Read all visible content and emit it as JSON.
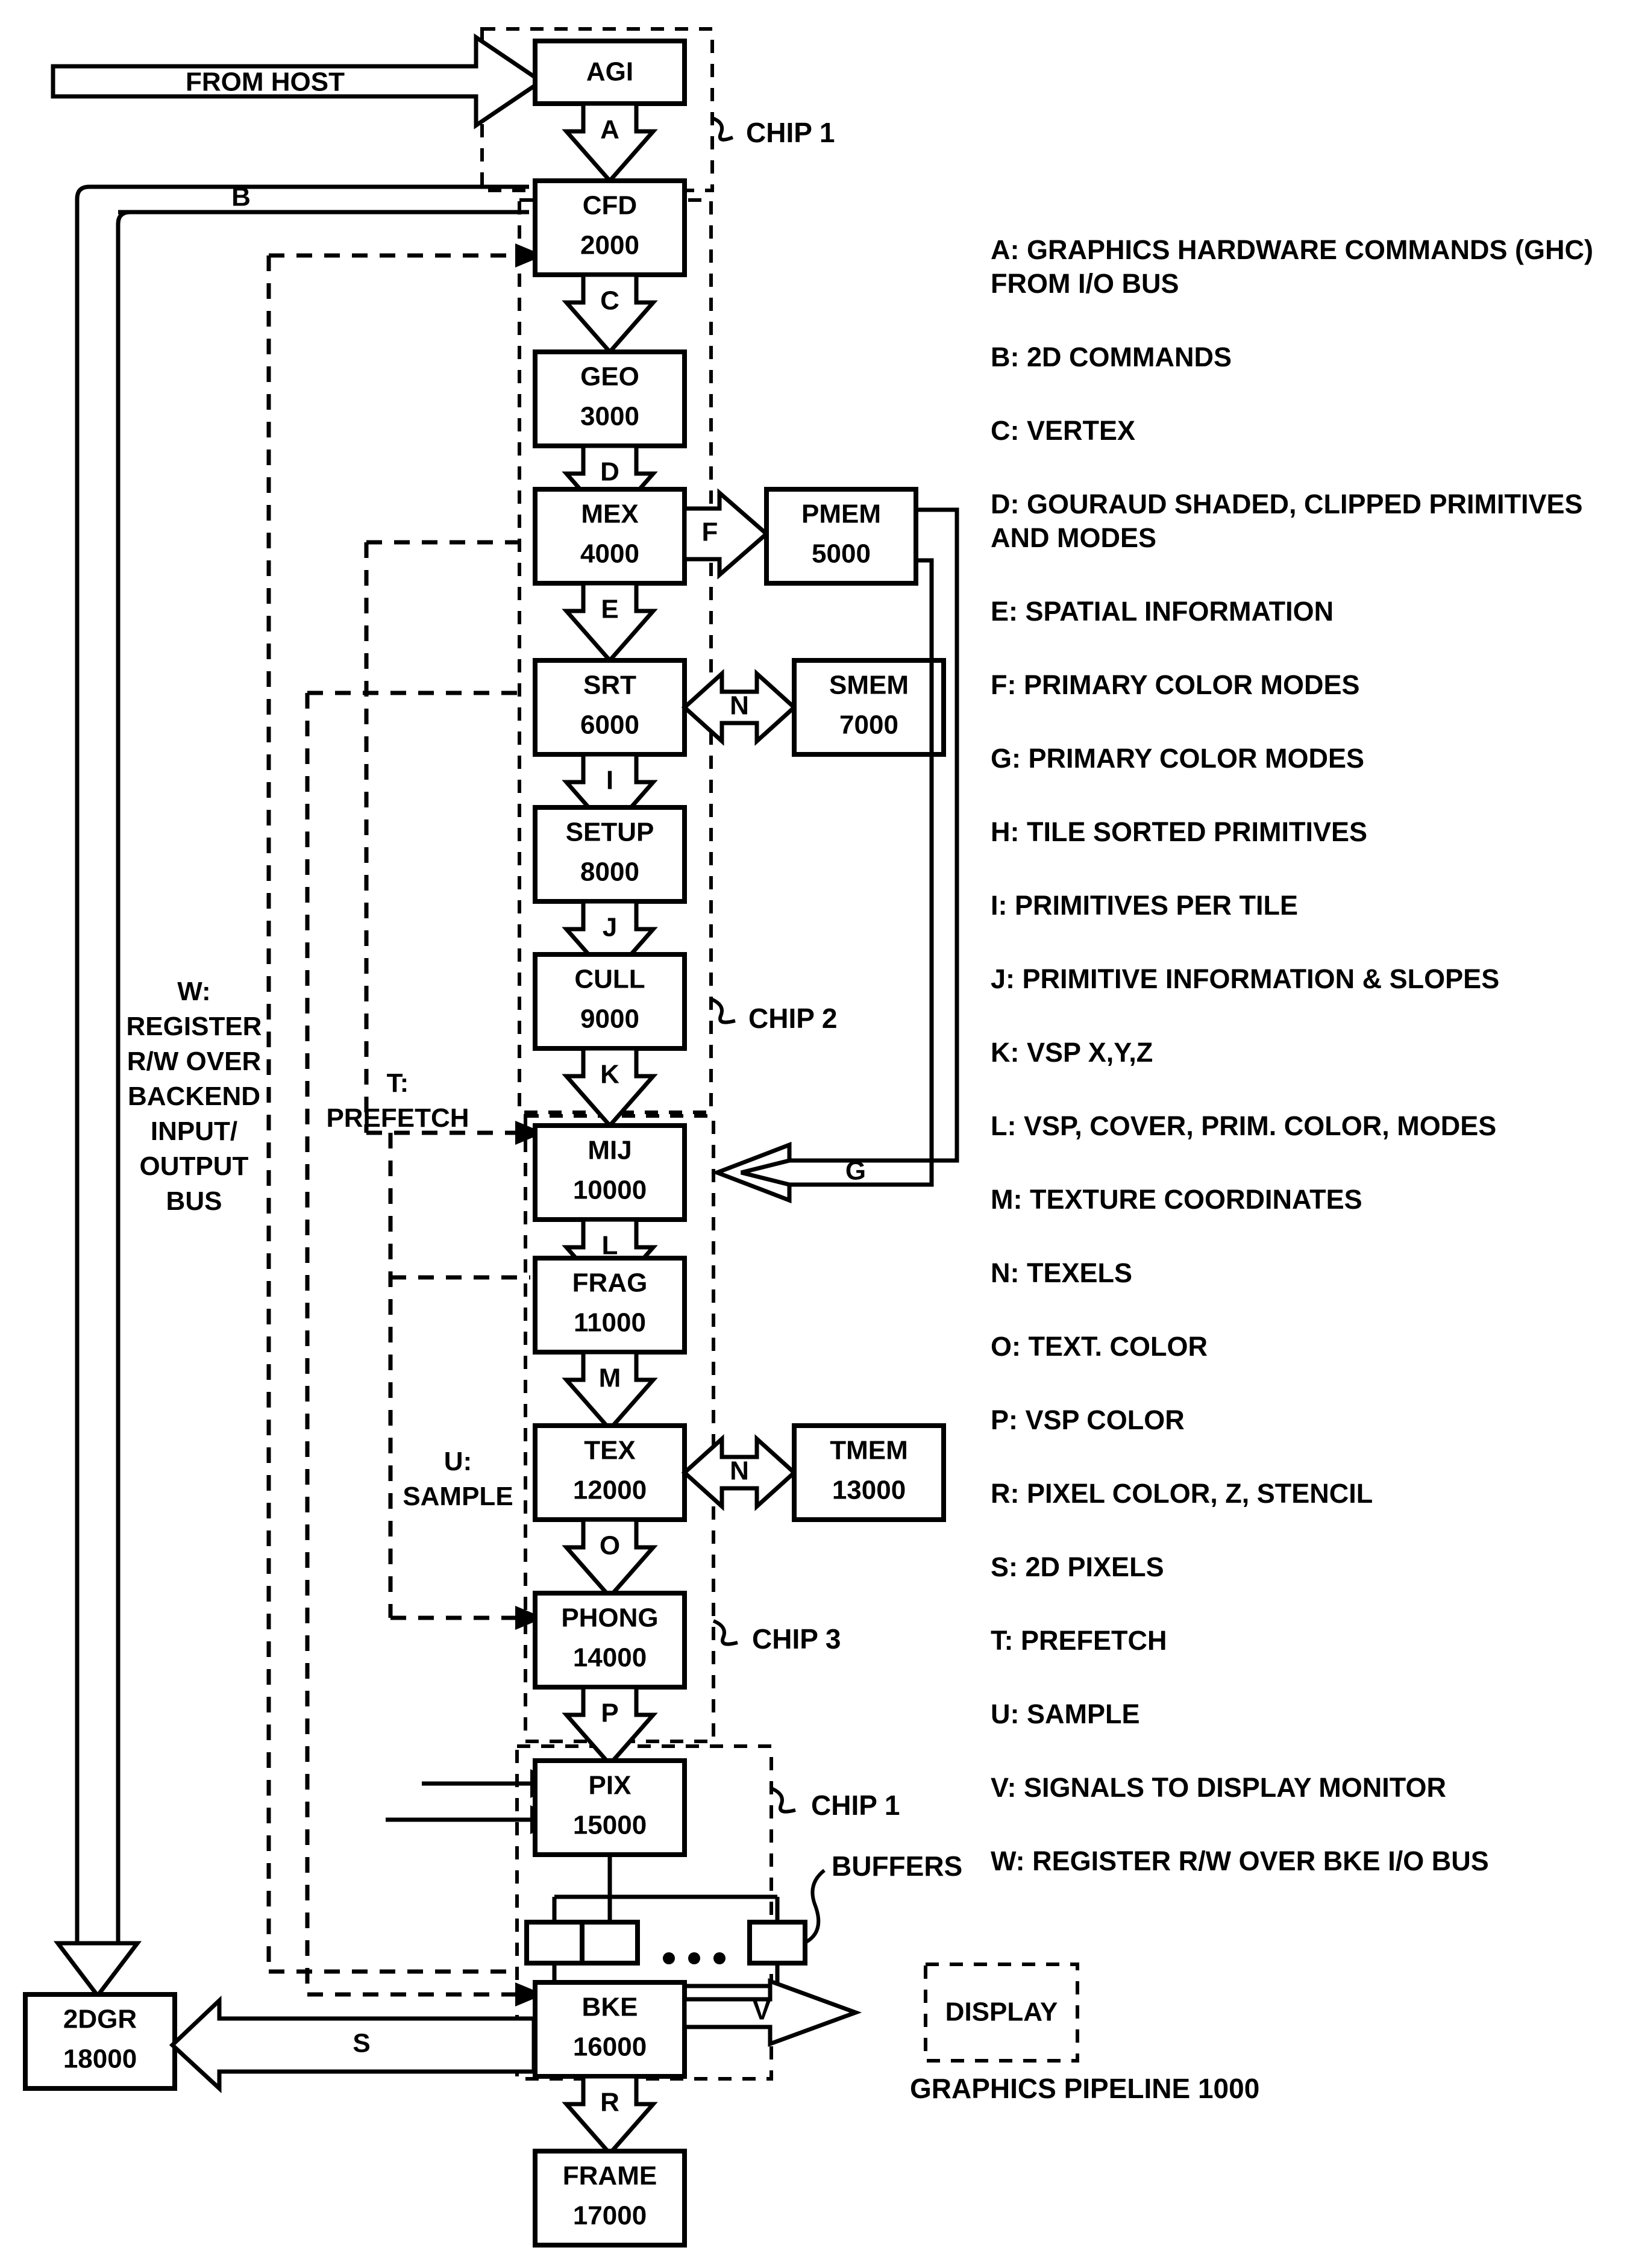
{
  "title": "GRAPHICS PIPELINE 1000",
  "blocks": [
    {
      "id": "agi",
      "name": "AGI",
      "num": ""
    },
    {
      "id": "cfd",
      "name": "CFD",
      "num": "2000"
    },
    {
      "id": "geo",
      "name": "GEO",
      "num": "3000"
    },
    {
      "id": "mex",
      "name": "MEX",
      "num": "4000"
    },
    {
      "id": "pmem",
      "name": "PMEM",
      "num": "5000"
    },
    {
      "id": "srt",
      "name": "SRT",
      "num": "6000"
    },
    {
      "id": "smem",
      "name": "SMEM",
      "num": "7000"
    },
    {
      "id": "setup",
      "name": "SETUP",
      "num": "8000"
    },
    {
      "id": "cull",
      "name": "CULL",
      "num": "9000"
    },
    {
      "id": "mij",
      "name": "MIJ",
      "num": "10000"
    },
    {
      "id": "frag",
      "name": "FRAG",
      "num": "11000"
    },
    {
      "id": "tex",
      "name": "TEX",
      "num": "12000"
    },
    {
      "id": "tmem",
      "name": "TMEM",
      "num": "13000"
    },
    {
      "id": "phong",
      "name": "PHONG",
      "num": "14000"
    },
    {
      "id": "pix",
      "name": "PIX",
      "num": "15000"
    },
    {
      "id": "bke",
      "name": "BKE",
      "num": "16000"
    },
    {
      "id": "frame",
      "name": "FRAME",
      "num": "17000"
    },
    {
      "id": "twodgr",
      "name": "2DGR",
      "num": "18000"
    },
    {
      "id": "display",
      "name": "DISPLAY",
      "num": ""
    }
  ],
  "flow_labels": {
    "a": "A",
    "b": "B",
    "c": "C",
    "d": "D",
    "e": "E",
    "f": "F",
    "g": "G",
    "i": "I",
    "j": "J",
    "k": "K",
    "l": "L",
    "m": "M",
    "n1": "N",
    "n2": "N",
    "o": "O",
    "p": "P",
    "r": "R",
    "s": "S",
    "v": "V"
  },
  "annotations": {
    "from_host": "FROM HOST",
    "chip1_top": "CHIP 1",
    "chip2": "CHIP 2",
    "chip3": "CHIP 3",
    "chip1_bottom": "CHIP 1",
    "buffers": "BUFFERS",
    "pipeline_caption": "GRAPHICS PIPELINE 1000"
  },
  "side_labels": {
    "w": [
      "W:",
      "REGISTER",
      "R/W OVER",
      "BACKEND",
      "INPUT/",
      "OUTPUT",
      "BUS"
    ],
    "t": [
      "T:",
      "PREFETCH"
    ],
    "u": [
      "U:",
      "SAMPLE"
    ]
  },
  "legend": [
    {
      "key": "A",
      "lines": [
        "A: GRAPHICS HARDWARE COMMANDS (GHC)",
        "FROM I/O BUS"
      ]
    },
    {
      "key": "B",
      "lines": [
        "B: 2D COMMANDS"
      ]
    },
    {
      "key": "C",
      "lines": [
        "C: VERTEX"
      ]
    },
    {
      "key": "D",
      "lines": [
        "D: GOURAUD SHADED, CLIPPED PRIMITIVES",
        "AND MODES"
      ]
    },
    {
      "key": "E",
      "lines": [
        "E: SPATIAL INFORMATION"
      ]
    },
    {
      "key": "F",
      "lines": [
        "F: PRIMARY COLOR MODES"
      ]
    },
    {
      "key": "G",
      "lines": [
        "G: PRIMARY COLOR MODES"
      ]
    },
    {
      "key": "H",
      "lines": [
        "H: TILE SORTED PRIMITIVES"
      ]
    },
    {
      "key": "I",
      "lines": [
        "I: PRIMITIVES PER TILE"
      ]
    },
    {
      "key": "J",
      "lines": [
        "J: PRIMITIVE INFORMATION & SLOPES"
      ]
    },
    {
      "key": "K",
      "lines": [
        "K: VSP X,Y,Z"
      ]
    },
    {
      "key": "L",
      "lines": [
        "L: VSP, COVER, PRIM. COLOR, MODES"
      ]
    },
    {
      "key": "M",
      "lines": [
        "M: TEXTURE COORDINATES"
      ]
    },
    {
      "key": "N",
      "lines": [
        "N: TEXELS"
      ]
    },
    {
      "key": "O",
      "lines": [
        "O: TEXT. COLOR"
      ]
    },
    {
      "key": "P",
      "lines": [
        "P: VSP COLOR"
      ]
    },
    {
      "key": "R",
      "lines": [
        "R: PIXEL COLOR, Z, STENCIL"
      ]
    },
    {
      "key": "S",
      "lines": [
        "S: 2D PIXELS"
      ]
    },
    {
      "key": "T",
      "lines": [
        "T: PREFETCH"
      ]
    },
    {
      "key": "U",
      "lines": [
        "U: SAMPLE"
      ]
    },
    {
      "key": "V",
      "lines": [
        "V: SIGNALS TO DISPLAY MONITOR"
      ]
    },
    {
      "key": "W",
      "lines": [
        "W: REGISTER R/W OVER BKE I/O BUS"
      ]
    }
  ],
  "colors": {
    "ink": "#000000",
    "paper": "#ffffff"
  }
}
